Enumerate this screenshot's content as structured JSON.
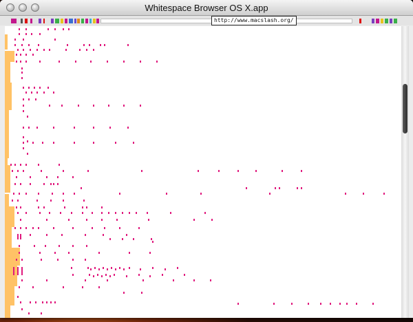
{
  "window": {
    "title": "Whitespace Browser OS X.app"
  },
  "toolbar": {
    "url_tooltip": "http://www.macslash.org/",
    "url_value": ""
  },
  "colors": {
    "whitespace_pink": "#e0197d",
    "indent_orange": "#ffc266",
    "page_background": "#ffffff"
  },
  "icons": {
    "close": "traffic-light-close-icon",
    "minimize": "traffic-light-minimize-icon",
    "zoom": "traffic-light-zoom-icon"
  }
}
